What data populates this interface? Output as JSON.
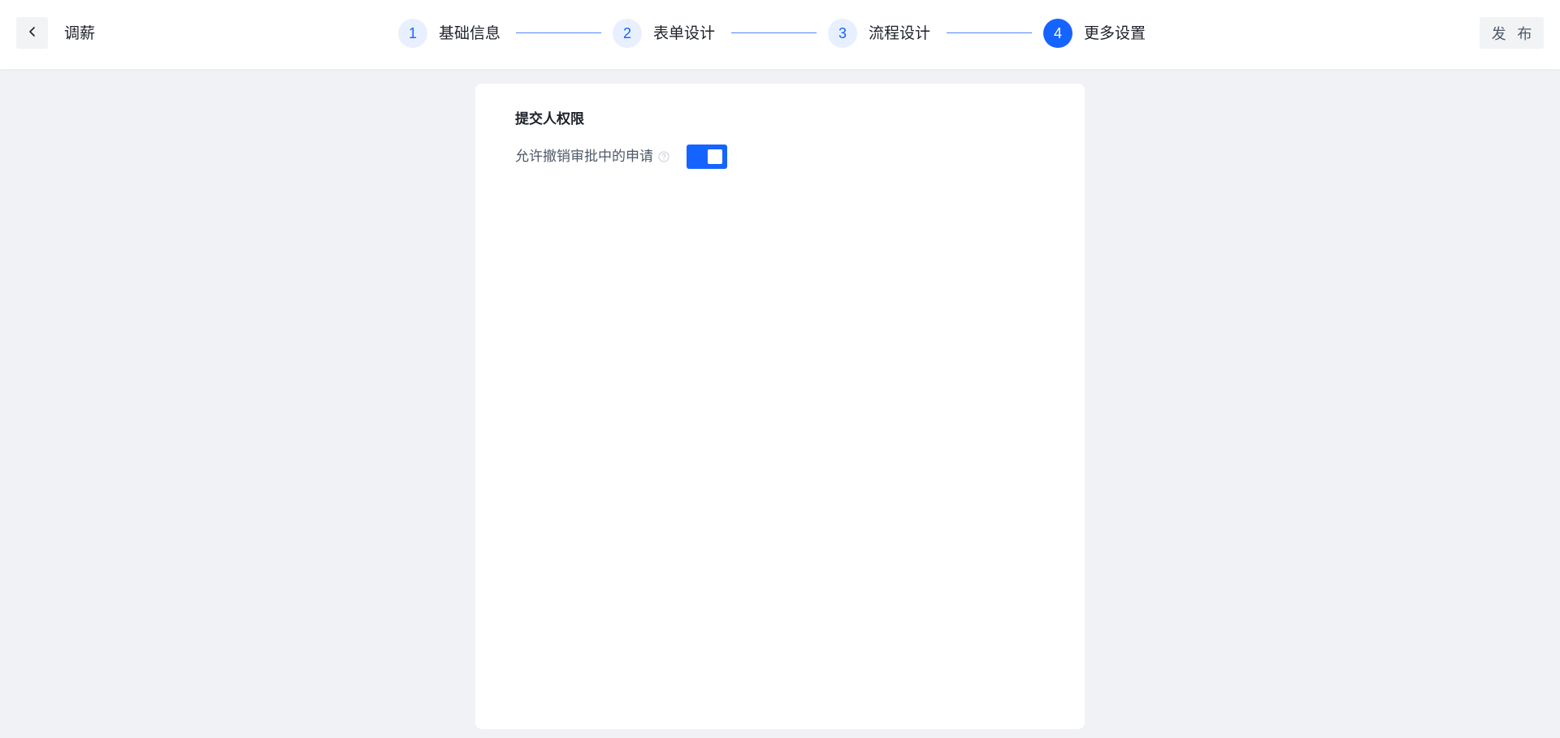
{
  "header": {
    "title": "调薪",
    "back_icon": "chevron-left-icon",
    "publish_label": "发 布"
  },
  "steps": [
    {
      "number": "1",
      "label": "基础信息",
      "state": "done"
    },
    {
      "number": "2",
      "label": "表单设计",
      "state": "done"
    },
    {
      "number": "3",
      "label": "流程设计",
      "state": "done"
    },
    {
      "number": "4",
      "label": "更多设置",
      "state": "active"
    }
  ],
  "card": {
    "section_title": "提交人权限",
    "setting": {
      "label": "允许撤销审批中的申请",
      "help_icon": "question-circle-icon",
      "enabled": true
    }
  },
  "colors": {
    "primary": "#1664ff",
    "step_inactive_bg": "#e8f0ff",
    "page_bg": "#f0f2f5"
  }
}
